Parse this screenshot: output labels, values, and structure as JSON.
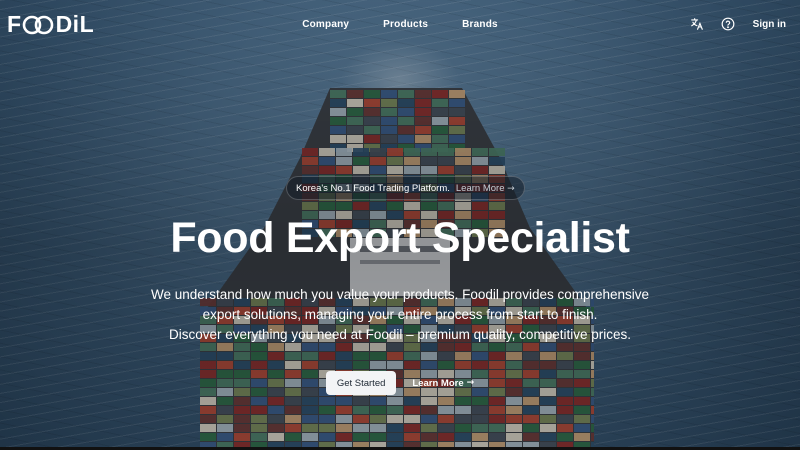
{
  "brand": {
    "name": "FOODIL"
  },
  "nav": {
    "items": [
      {
        "label": "Company"
      },
      {
        "label": "Products"
      },
      {
        "label": "Brands"
      }
    ],
    "sign_in": "Sign in",
    "icons": [
      "translate-icon",
      "help-circle-icon"
    ]
  },
  "hero": {
    "announcement": {
      "text": "Korea's No.1 Food Trading Platform.",
      "link": "Learn More",
      "link_icon": "arrow-right-icon"
    },
    "title": "Food Export Specialist",
    "description": [
      "We understand how much you value your products. Foodil provides comprehensive",
      "export solutions, managing your entire process from start to finish.",
      "Discover everything you need at Foodil – premium quality, competitive prices."
    ],
    "primary_cta": "Get Started",
    "secondary_cta": "Learn More",
    "secondary_cta_icon": "arrow-right-icon"
  }
}
